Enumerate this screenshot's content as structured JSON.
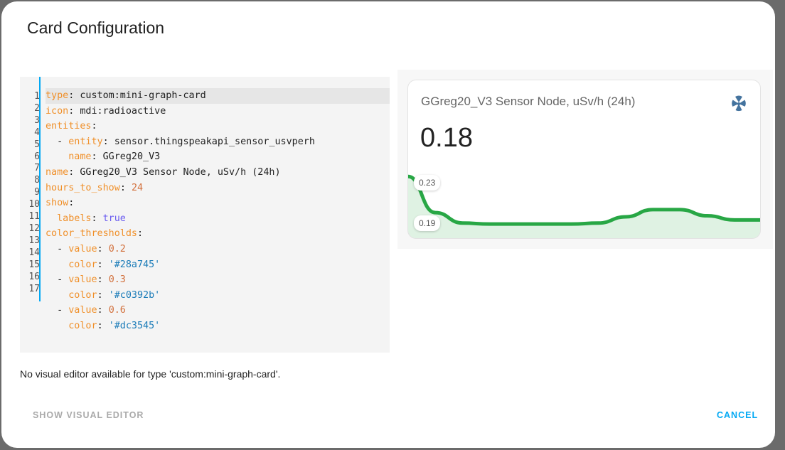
{
  "dialog": {
    "title": "Card Configuration"
  },
  "editor": {
    "line_numbers": [
      "1",
      "2",
      "3",
      "4",
      "5",
      "6",
      "7",
      "8",
      "9",
      "10",
      "11",
      "12",
      "13",
      "14",
      "15",
      "16",
      "17"
    ],
    "lines": [
      [
        [
          "k",
          "type"
        ],
        [
          "",
          ": custom:mini-graph-card"
        ]
      ],
      [
        [
          "k",
          "icon"
        ],
        [
          "",
          ": mdi:radioactive"
        ]
      ],
      [
        [
          "k",
          "entities"
        ],
        [
          "",
          ":"
        ]
      ],
      [
        [
          "",
          "  - "
        ],
        [
          "k",
          "entity"
        ],
        [
          "",
          ": sensor.thingspeakapi_sensor_usvperh"
        ]
      ],
      [
        [
          "",
          "    "
        ],
        [
          "k",
          "name"
        ],
        [
          "",
          ": GGreg20_V3"
        ]
      ],
      [
        [
          "k",
          "name"
        ],
        [
          "",
          ": GGreg20_V3 Sensor Node, uSv/h (24h)"
        ]
      ],
      [
        [
          "k",
          "hours_to_show"
        ],
        [
          "",
          ": "
        ],
        [
          "n",
          "24"
        ]
      ],
      [
        [
          "k",
          "show"
        ],
        [
          "",
          ":"
        ]
      ],
      [
        [
          "",
          "  "
        ],
        [
          "k",
          "labels"
        ],
        [
          "",
          ": "
        ],
        [
          "b",
          "true"
        ]
      ],
      [
        [
          "k",
          "color_thresholds"
        ],
        [
          "",
          ":"
        ]
      ],
      [
        [
          "",
          "  - "
        ],
        [
          "k",
          "value"
        ],
        [
          "",
          ": "
        ],
        [
          "n",
          "0.2"
        ]
      ],
      [
        [
          "",
          "    "
        ],
        [
          "k",
          "color"
        ],
        [
          "",
          ": "
        ],
        [
          "s",
          "'#28a745'"
        ]
      ],
      [
        [
          "",
          "  - "
        ],
        [
          "k",
          "value"
        ],
        [
          "",
          ": "
        ],
        [
          "n",
          "0.3"
        ]
      ],
      [
        [
          "",
          "    "
        ],
        [
          "k",
          "color"
        ],
        [
          "",
          ": "
        ],
        [
          "s",
          "'#c0392b'"
        ]
      ],
      [
        [
          "",
          "  - "
        ],
        [
          "k",
          "value"
        ],
        [
          "",
          ": "
        ],
        [
          "n",
          "0.6"
        ]
      ],
      [
        [
          "",
          "    "
        ],
        [
          "k",
          "color"
        ],
        [
          "",
          ": "
        ],
        [
          "s",
          "'#dc3545'"
        ]
      ]
    ]
  },
  "note": "No visual editor available for type 'custom:mini-graph-card'.",
  "preview": {
    "name": "GGreg20_V3 Sensor Node, uSv/h (24h)",
    "icon": "radioactive-icon",
    "icon_color": "#44739e",
    "state": "0.18",
    "line_color": "#28a745",
    "label_max": "0.23",
    "label_min": "0.19",
    "values": [
      0.235,
      0.2,
      0.19,
      0.189,
      0.189,
      0.189,
      0.189,
      0.19,
      0.196,
      0.203,
      0.203,
      0.197,
      0.193,
      0.193
    ]
  },
  "buttons": {
    "show_visual": "SHOW VISUAL EDITOR",
    "cancel": "CANCEL"
  }
}
